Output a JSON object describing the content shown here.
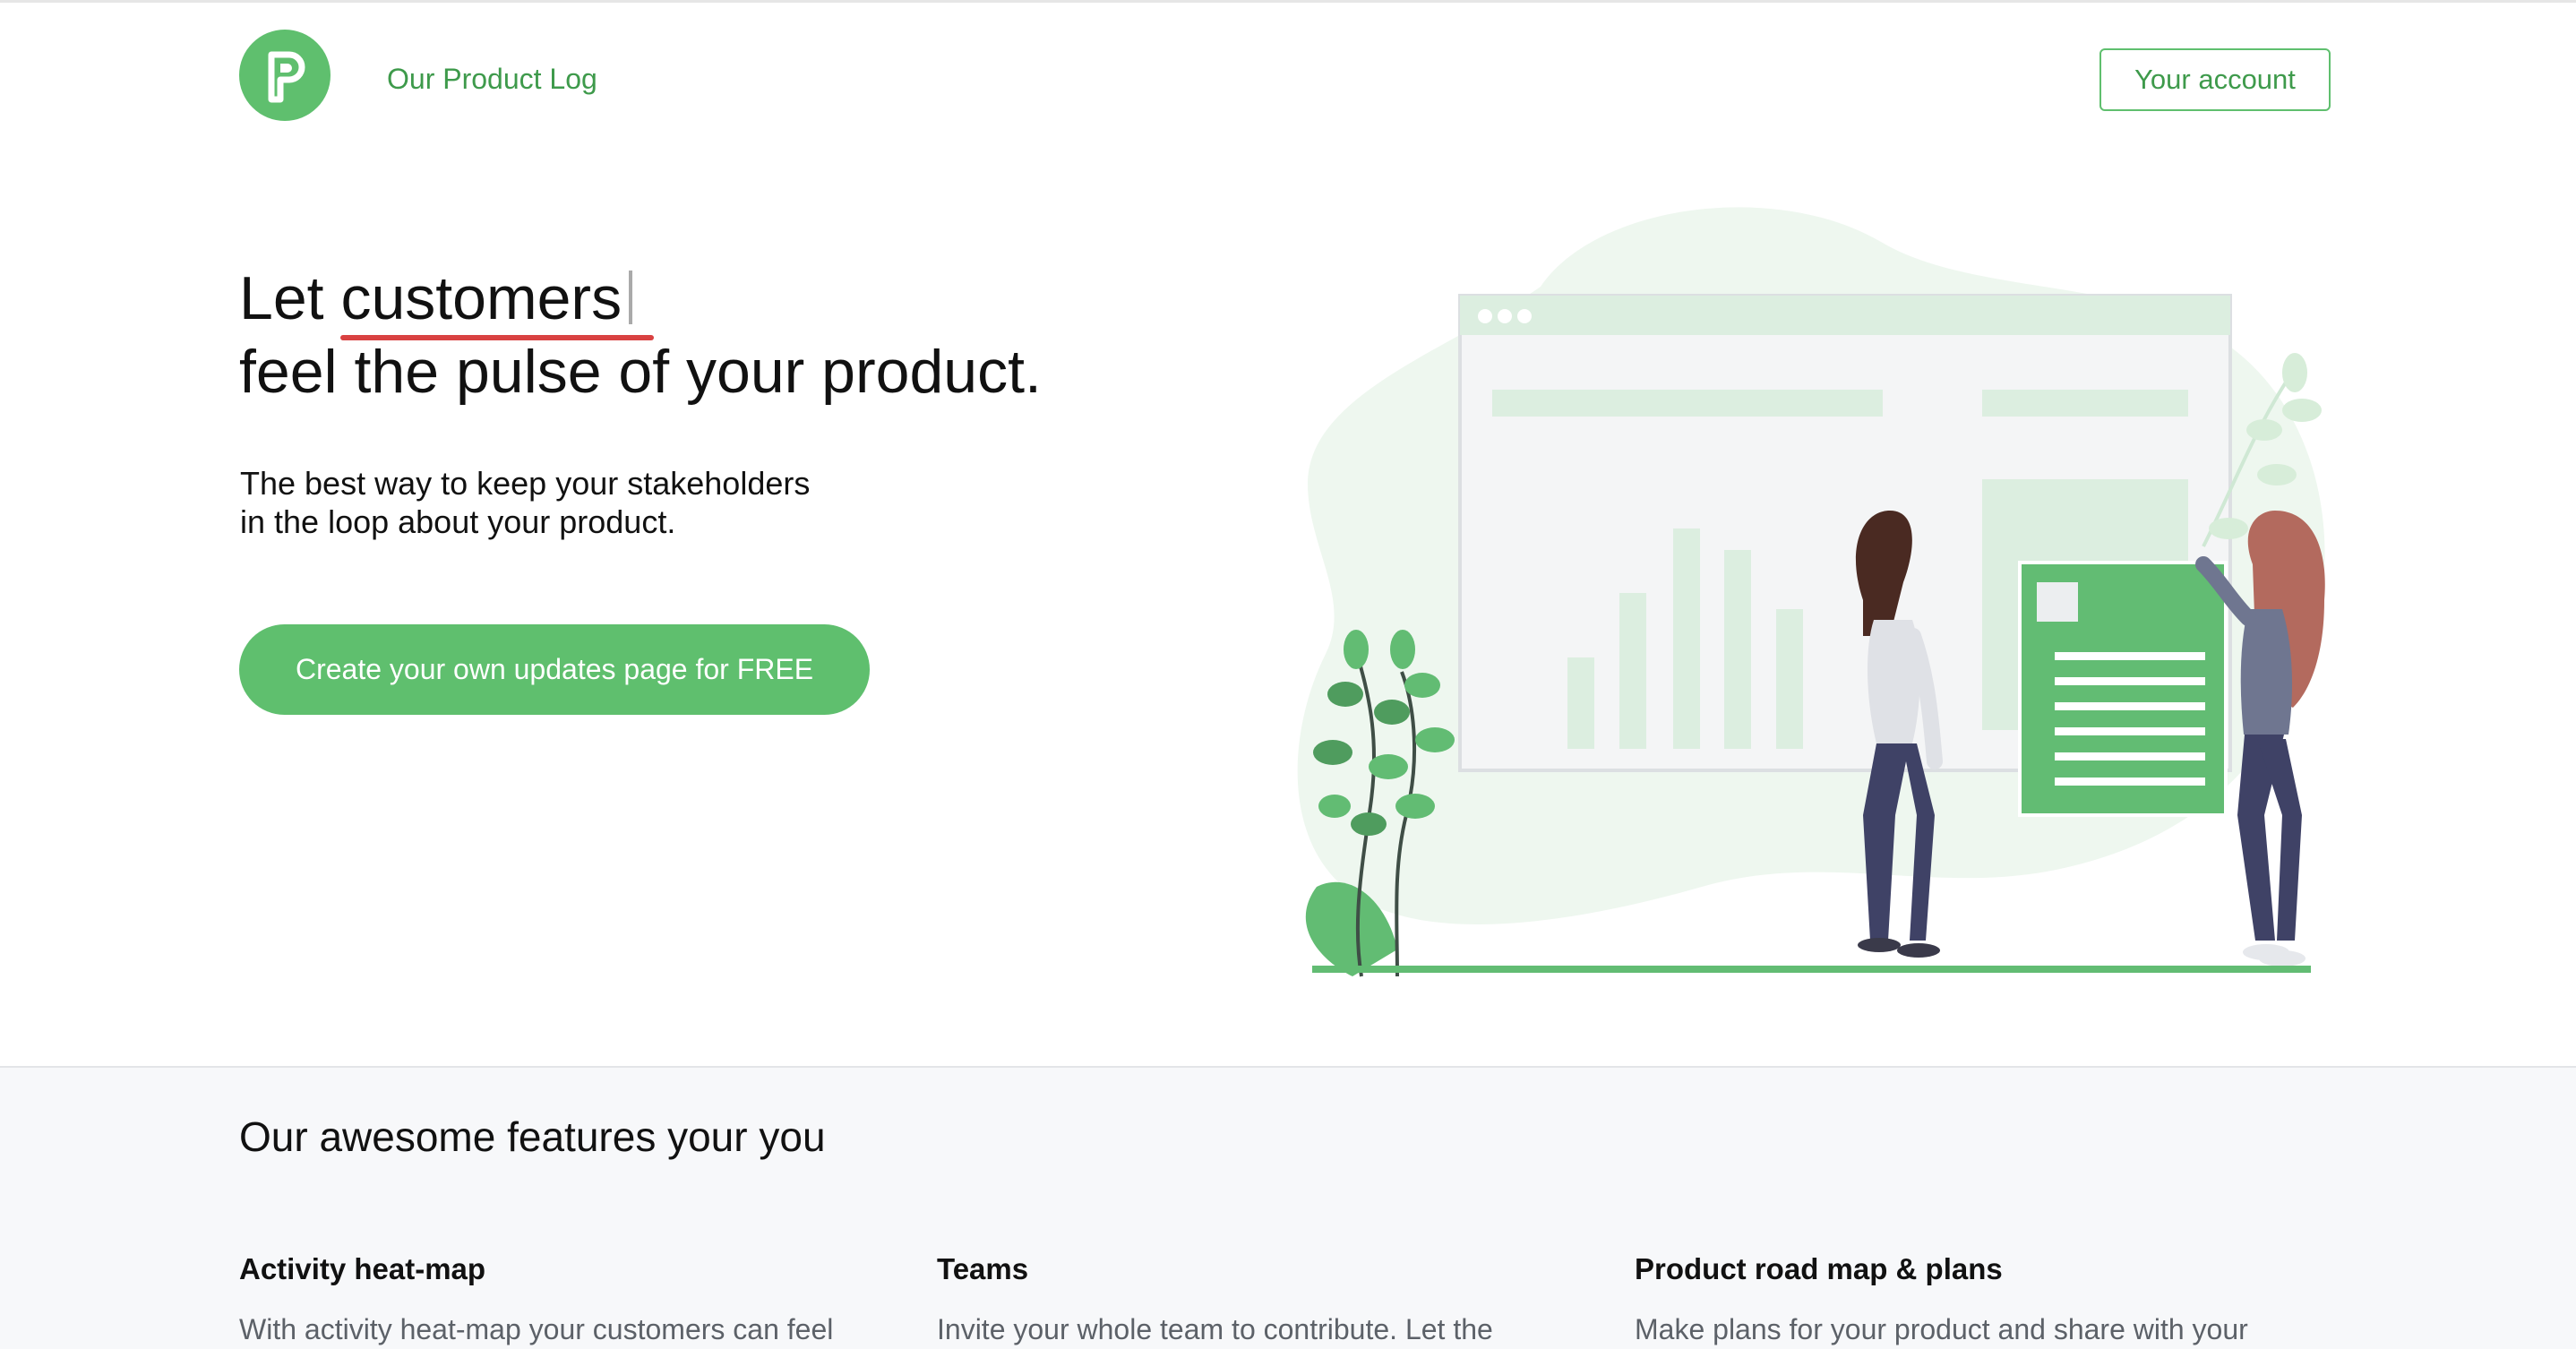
{
  "header": {
    "brand": "Our Product Log",
    "account_button": "Your account"
  },
  "hero": {
    "title_prefix": "Let",
    "title_highlight": "customers",
    "title_line2": "feel the pulse of your product.",
    "subtitle_line1": "The best way to keep your stakeholders",
    "subtitle_line2": "in the loop about your product.",
    "cta_label": "Create your own updates page for FREE"
  },
  "features": {
    "title": "Our awesome features your you",
    "items": [
      {
        "title": "Activity heat-map",
        "description": "With activity heat-map your customers can feel"
      },
      {
        "title": "Teams",
        "description": "Invite your whole team to contribute. Let the"
      },
      {
        "title": "Product road map & plans",
        "description": "Make plans for your product and share with your"
      }
    ]
  },
  "colors": {
    "brand_green": "#5fbf6e",
    "brand_green_dark": "#3e9a4b",
    "highlight_red": "#d94141"
  },
  "icons": {
    "logo": "p-letter-logo",
    "illustration": "people-presenting-dashboard"
  }
}
